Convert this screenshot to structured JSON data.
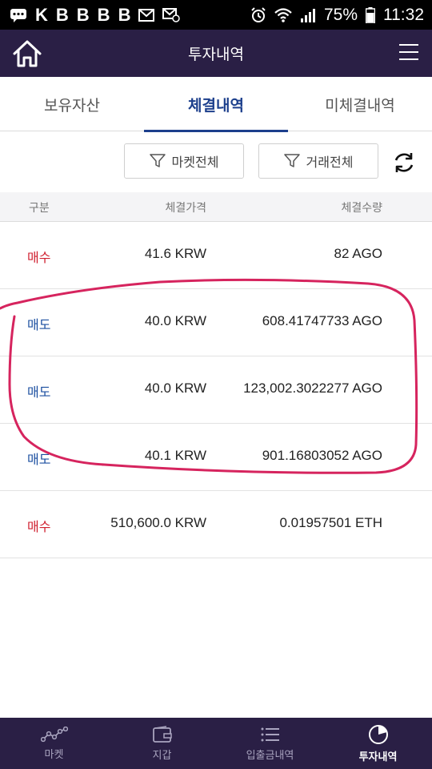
{
  "status_bar": {
    "battery": "75%",
    "time": "11:32"
  },
  "header": {
    "title": "투자내역"
  },
  "tabs": [
    {
      "label": "보유자산",
      "active": false
    },
    {
      "label": "체결내역",
      "active": true
    },
    {
      "label": "미체결내역",
      "active": false
    }
  ],
  "filters": {
    "market": "마켓전체",
    "trade": "거래전체"
  },
  "table": {
    "columns": [
      "구분",
      "체결가격",
      "체결수량"
    ],
    "rows": [
      {
        "type": "매수",
        "price": "41.6 KRW",
        "quantity": "82 AGO"
      },
      {
        "type": "매도",
        "price": "40.0 KRW",
        "quantity": "608.41747733 AGO"
      },
      {
        "type": "매도",
        "price": "40.0 KRW",
        "quantity": "123,002.3022277 AGO"
      },
      {
        "type": "매도",
        "price": "40.1 KRW",
        "quantity": "901.16803052 AGO"
      },
      {
        "type": "매수",
        "price": "510,600.0 KRW",
        "quantity": "0.01957501 ETH"
      }
    ]
  },
  "bottom_nav": [
    {
      "label": "마켓",
      "icon": "chart-line-icon",
      "active": false
    },
    {
      "label": "지갑",
      "icon": "wallet-icon",
      "active": false
    },
    {
      "label": "입출금내역",
      "icon": "list-icon",
      "active": false
    },
    {
      "label": "투자내역",
      "icon": "pie-chart-icon",
      "active": true
    }
  ],
  "colors": {
    "header_bg": "#2a1f45",
    "accent": "#1c3f8c",
    "buy": "#d0202f",
    "sell": "#1c4fa0",
    "annotation": "#d6245e"
  }
}
